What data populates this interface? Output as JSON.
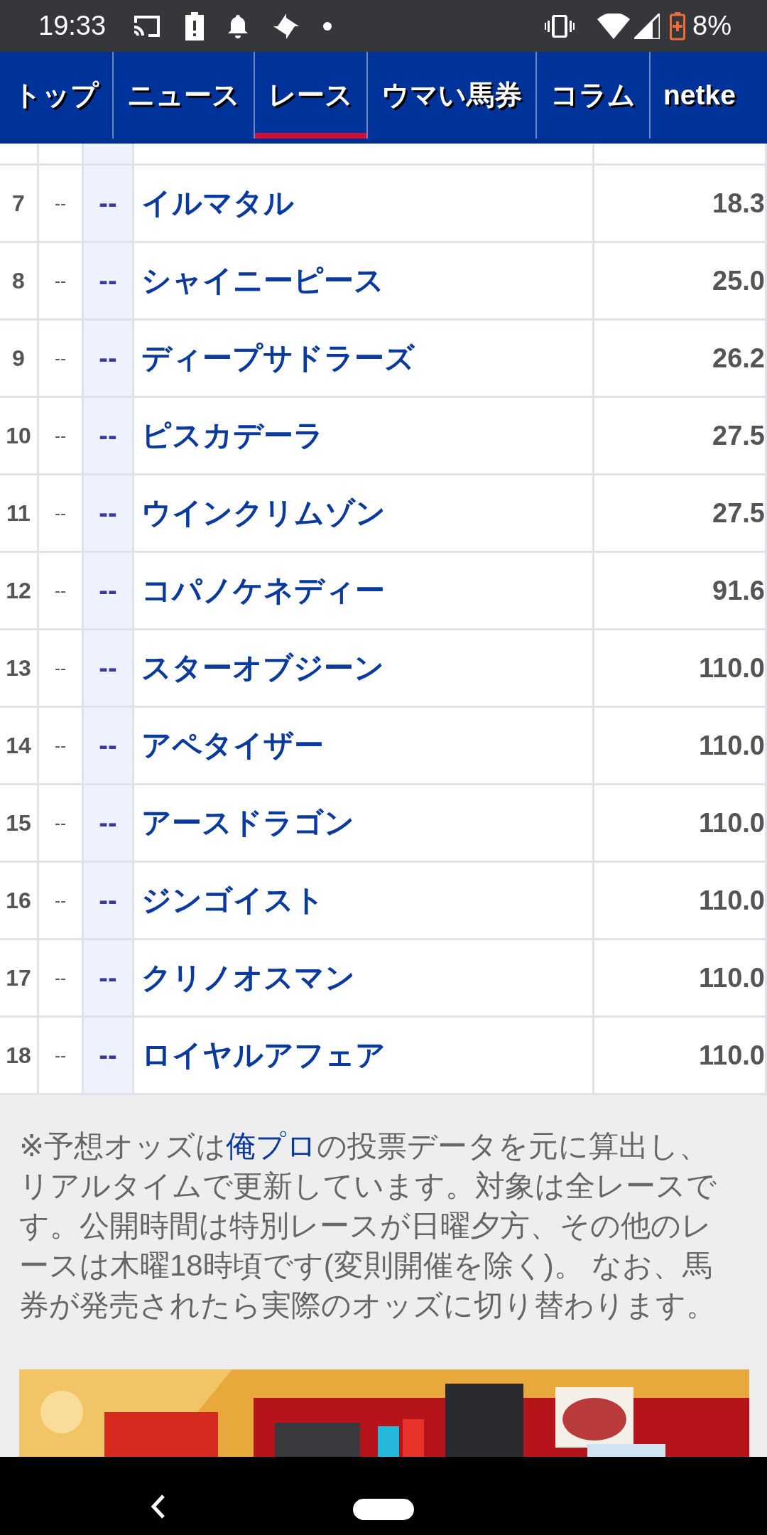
{
  "status_bar": {
    "time": "19:33",
    "battery": "8%"
  },
  "nav": {
    "tabs": [
      {
        "label": "トップ",
        "selected": false
      },
      {
        "label": "ニュース",
        "selected": false
      },
      {
        "label": "レース",
        "selected": true
      },
      {
        "label": "ウマい馬券",
        "selected": false
      },
      {
        "label": "コラム",
        "selected": false
      },
      {
        "label": "netke",
        "selected": false
      }
    ]
  },
  "table": {
    "rows": [
      {
        "number": "7",
        "column_2": "--",
        "column_3": "--",
        "name": "イルマタル",
        "odds": "18.3"
      },
      {
        "number": "8",
        "column_2": "--",
        "column_3": "--",
        "name": "シャイニーピース",
        "odds": "25.0"
      },
      {
        "number": "9",
        "column_2": "--",
        "column_3": "--",
        "name": "ディープサドラーズ",
        "odds": "26.2"
      },
      {
        "number": "10",
        "column_2": "--",
        "column_3": "--",
        "name": "ピスカデーラ",
        "odds": "27.5"
      },
      {
        "number": "11",
        "column_2": "--",
        "column_3": "--",
        "name": "ウインクリムゾン",
        "odds": "27.5"
      },
      {
        "number": "12",
        "column_2": "--",
        "column_3": "--",
        "name": "コパノケネディー",
        "odds": "91.6"
      },
      {
        "number": "13",
        "column_2": "--",
        "column_3": "--",
        "name": "スターオブジーン",
        "odds": "110.0"
      },
      {
        "number": "14",
        "column_2": "--",
        "column_3": "--",
        "name": "アペタイザー",
        "odds": "110.0"
      },
      {
        "number": "15",
        "column_2": "--",
        "column_3": "--",
        "name": "アースドラゴン",
        "odds": "110.0"
      },
      {
        "number": "16",
        "column_2": "--",
        "column_3": "--",
        "name": "ジンゴイスト",
        "odds": "110.0"
      },
      {
        "number": "17",
        "column_2": "--",
        "column_3": "--",
        "name": "クリノオスマン",
        "odds": "110.0"
      },
      {
        "number": "18",
        "column_2": "--",
        "column_3": "--",
        "name": "ロイヤルアフェア",
        "odds": "110.0"
      }
    ]
  },
  "note": {
    "before": "※予想オッズは",
    "link": "俺プロ",
    "after": "の投票データを元に算出し、リアルタイムで更新しています。対象は全レースです。公開時間は特別レースが日曜夕方、その他のレースは木曜18時頃です(変則開催を除く)。 なお、馬券が発売されたら実際のオッズに切り替わります。"
  }
}
